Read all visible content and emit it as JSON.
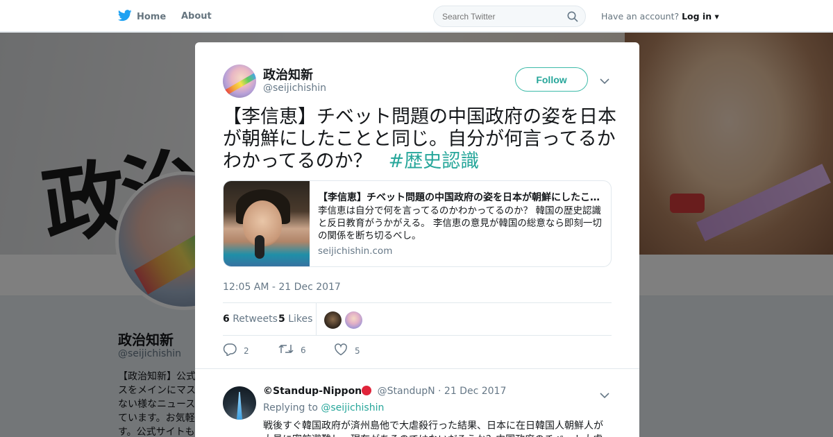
{
  "nav": {
    "home_label": "Home",
    "about_label": "About",
    "search_placeholder": "Search Twitter",
    "have_account": "Have an account?",
    "login_label": "Log in",
    "close_glyph": "✕"
  },
  "background_profile": {
    "banner_text": "政治",
    "name": "政治知新",
    "handle": "@seijichishin",
    "bio": "【政治知新】公式スをメインにマスない様なニュースています。お気軽す。公式サイトも"
  },
  "tweet": {
    "author_name": "政治知新",
    "author_handle": "@seijichishin",
    "follow_label": "Follow",
    "text": "【李信恵】チベット問題の中国政府の姿を日本が朝鮮にしたことと同じ。自分が何言ってるかわかってるのか？",
    "hashtag": "#歴史認識",
    "card": {
      "title": "【李信恵】チベット問題の中国政府の姿を日本が朝鮮にしたことと同じ。自分が何言ってるかわかってるのか？",
      "description": "李信恵は自分で何を言ってるのかわかってるのか？ 韓国の歴史認識と反日教育がうかがえる。 李信恵の意見が韓国の総意なら即刻一切の関係を断ち切るべし。",
      "domain": "seijichishin.com"
    },
    "timestamp": "12:05 AM - 21 Dec 2017",
    "stats": {
      "retweets_count": "6",
      "retweets_label": "Retweets",
      "likes_count": "5",
      "likes_label": "Likes"
    },
    "actions": {
      "replies": "2",
      "retweets": "6",
      "likes": "5"
    }
  },
  "reply": {
    "name": "©Standup-Nippon",
    "handle": "@StandupN",
    "separator": "·",
    "date": "21 Dec 2017",
    "replying_prefix": "Replying to",
    "replying_to": "@seijichishin",
    "text": "戦後すぐ韓国政府が済州島他で大虐殺行った結果、日本に在日韓国人朝鮮人が大量に密航避難し、現在があるのではないだろうか？中国政府のチベット大虐"
  },
  "colors": {
    "accent": "#26a69a",
    "twitter_blue": "#1da1f2",
    "text_primary": "#14171a",
    "text_secondary": "#657786"
  }
}
